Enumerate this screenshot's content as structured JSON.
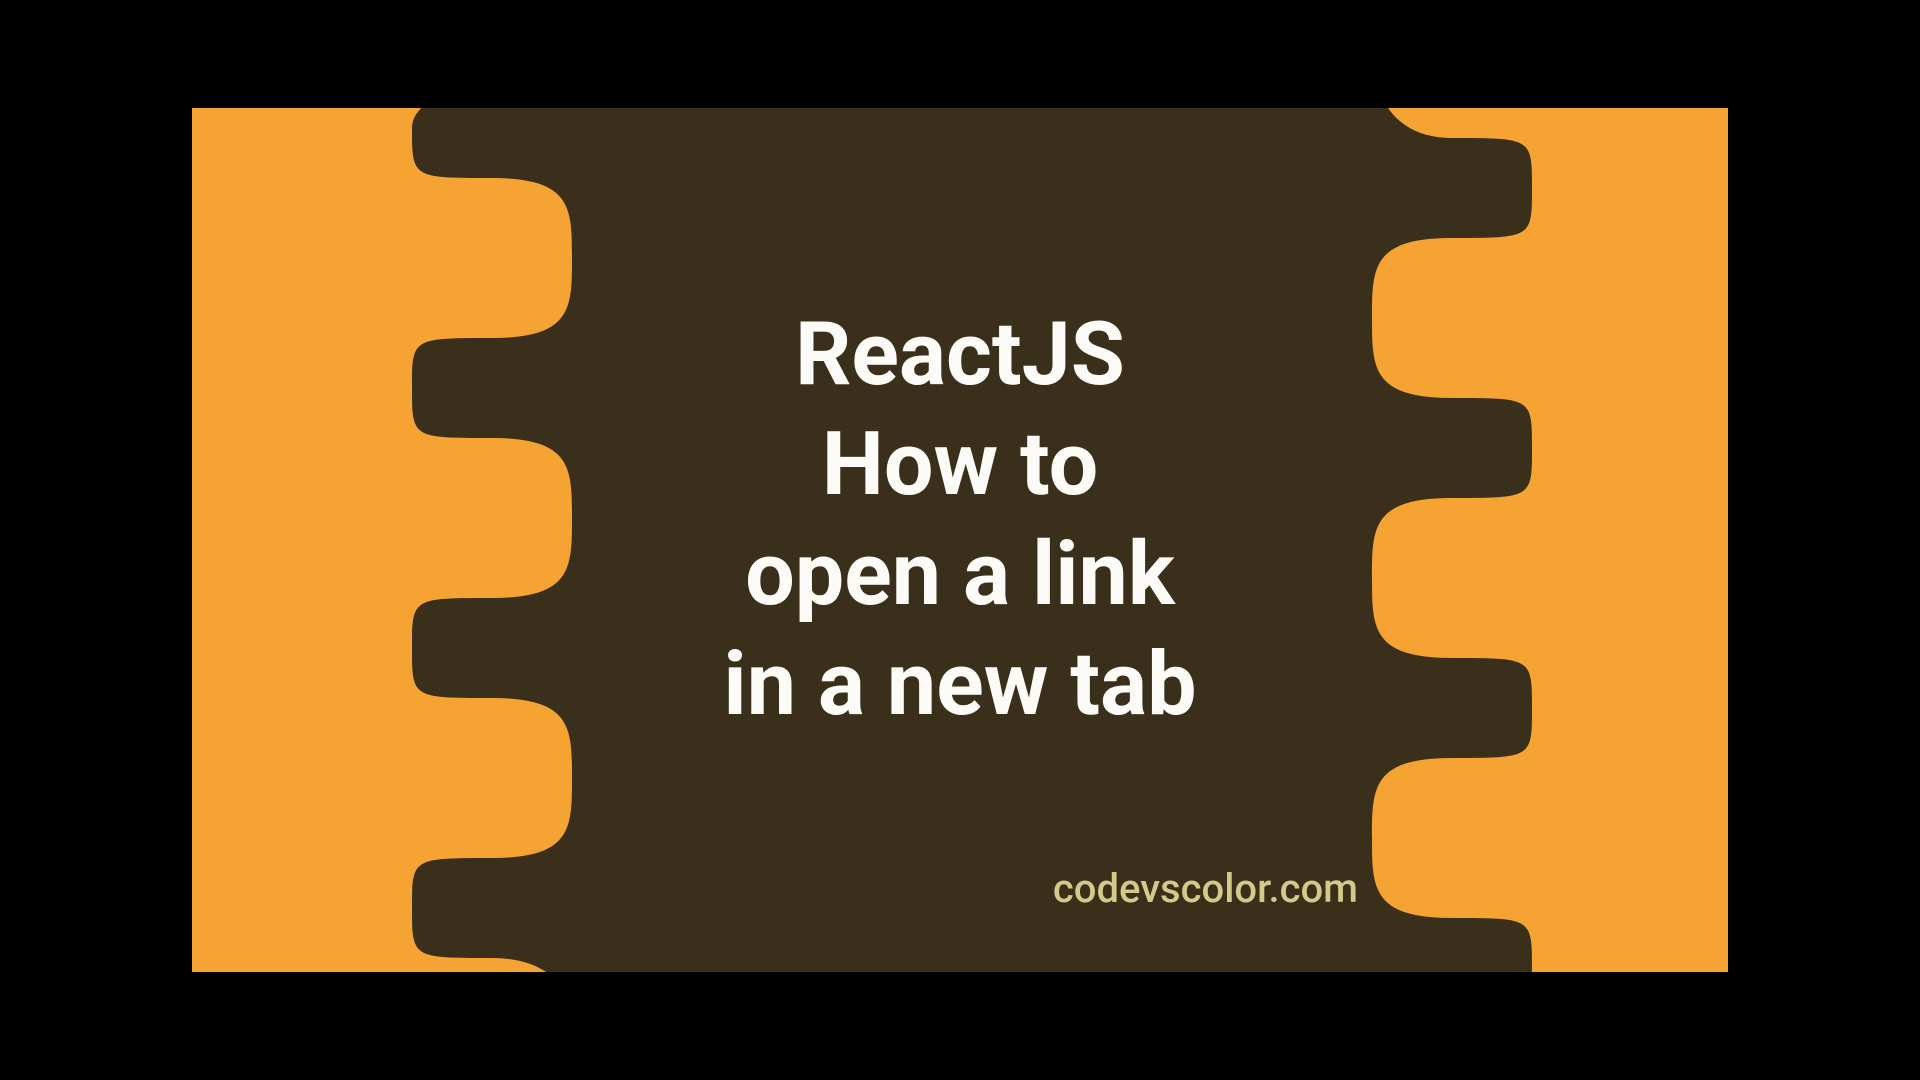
{
  "title": {
    "line1": "ReactJS",
    "line2": "How to",
    "line3": "open a link",
    "line4": "in a new tab"
  },
  "watermark": "codevscolor.com",
  "colors": {
    "background": "#f5a332",
    "blob": "#3a2f1a",
    "text": "#fdfbf7",
    "watermark": "#d4c88a"
  }
}
